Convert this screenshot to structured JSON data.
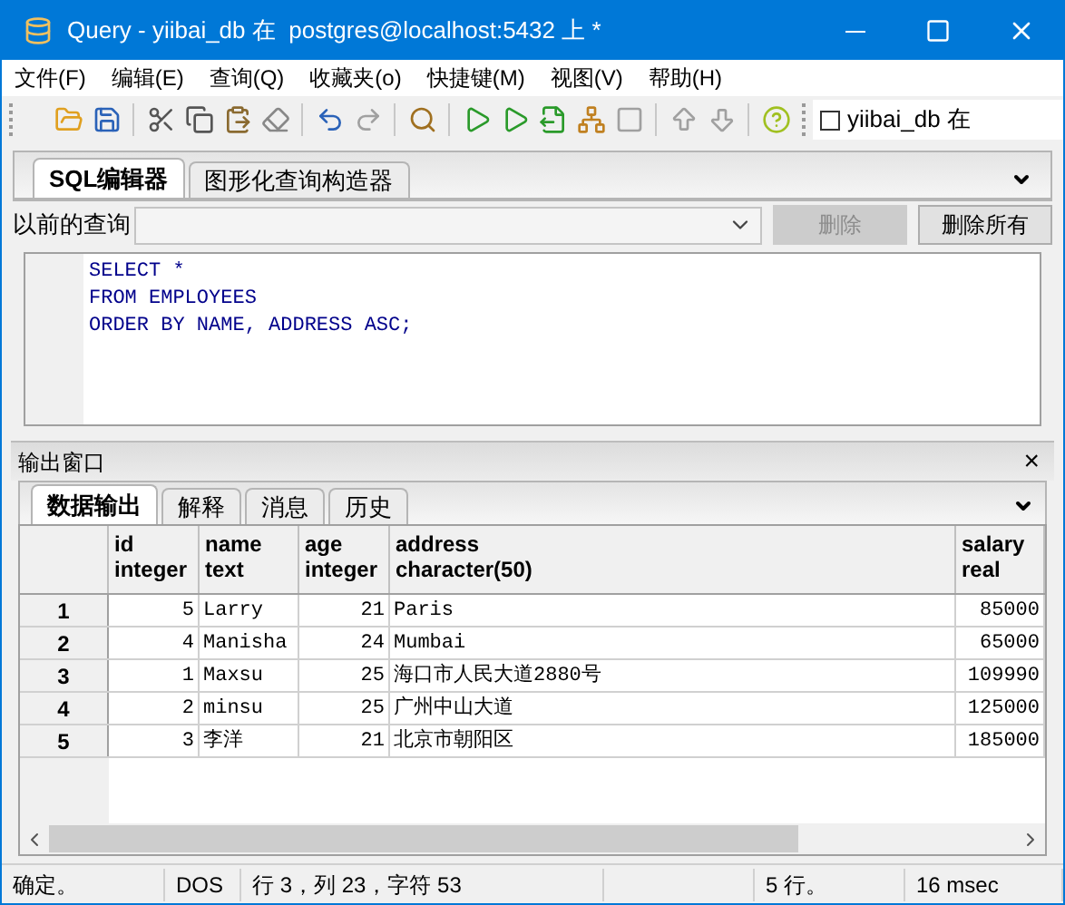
{
  "window": {
    "title": "Query - yiibai_db 在  postgres@localhost:5432 上 *"
  },
  "menu": [
    "文件(F)",
    "编辑(E)",
    "查询(Q)",
    "收藏夹(o)",
    "快捷键(M)",
    "视图(V)",
    "帮助(H)"
  ],
  "toolbar": {
    "buttons": [
      {
        "kind": "open",
        "disabled": false
      },
      {
        "kind": "save",
        "disabled": false
      },
      {
        "kind": "sep"
      },
      {
        "kind": "cut",
        "disabled": false
      },
      {
        "kind": "copy",
        "disabled": false
      },
      {
        "kind": "paste",
        "disabled": false
      },
      {
        "kind": "erase",
        "disabled": false
      },
      {
        "kind": "sep"
      },
      {
        "kind": "undo",
        "disabled": false
      },
      {
        "kind": "redo",
        "disabled": true
      },
      {
        "kind": "sep"
      },
      {
        "kind": "find",
        "disabled": false
      },
      {
        "kind": "sep"
      },
      {
        "kind": "run",
        "disabled": false
      },
      {
        "kind": "explain",
        "disabled": false
      },
      {
        "kind": "run-file",
        "disabled": false
      },
      {
        "kind": "tree",
        "disabled": false
      },
      {
        "kind": "stop",
        "disabled": true
      },
      {
        "kind": "sep"
      },
      {
        "kind": "upload",
        "disabled": true
      },
      {
        "kind": "download",
        "disabled": true
      },
      {
        "kind": "sep"
      },
      {
        "kind": "help",
        "disabled": false
      }
    ],
    "db_checkbox": {
      "label": "yiibai_db 在",
      "checked": false
    }
  },
  "editor_tabs": [
    {
      "label": "SQL编辑器",
      "selected": true
    },
    {
      "label": "图形化查询构造器",
      "selected": false
    }
  ],
  "previous_query": {
    "label": "以前的查询",
    "delete": {
      "label": "删除",
      "disabled": true
    },
    "delete_all": {
      "label": "删除所有",
      "disabled": false
    }
  },
  "sql": [
    "SELECT *",
    "FROM EMPLOYEES",
    "ORDER BY NAME, ADDRESS ASC;"
  ],
  "output": {
    "title": "输出窗口",
    "close": "×",
    "tabs": [
      {
        "label": "数据输出",
        "selected": true
      },
      {
        "label": "解释",
        "selected": false
      },
      {
        "label": "消息",
        "selected": false
      },
      {
        "label": "历史",
        "selected": false
      }
    ],
    "table": {
      "columns": [
        {
          "name": "id",
          "type": "integer"
        },
        {
          "name": "name",
          "type": "text"
        },
        {
          "name": "age",
          "type": "integer"
        },
        {
          "name": "address",
          "type": "character(50)"
        },
        {
          "name": "salary",
          "type": "real"
        }
      ],
      "rows": [
        {
          "num": "1",
          "cells": [
            "5",
            "Larry",
            "21",
            "Paris",
            "85000"
          ]
        },
        {
          "num": "2",
          "cells": [
            "4",
            "Manisha",
            "24",
            "Mumbai",
            "65000"
          ]
        },
        {
          "num": "3",
          "cells": [
            "1",
            "Maxsu",
            "25",
            "海口市人民大道2880号",
            "109990"
          ]
        },
        {
          "num": "4",
          "cells": [
            "2",
            "minsu",
            "25",
            "广州中山大道",
            "125000"
          ]
        },
        {
          "num": "5",
          "cells": [
            "3",
            "李洋",
            "21",
            "北京市朝阳区",
            "185000"
          ]
        }
      ]
    }
  },
  "status_bar": [
    "确定。",
    "DOS",
    "行 3，列 23，字符 53",
    "5 行。",
    "16 msec"
  ]
}
